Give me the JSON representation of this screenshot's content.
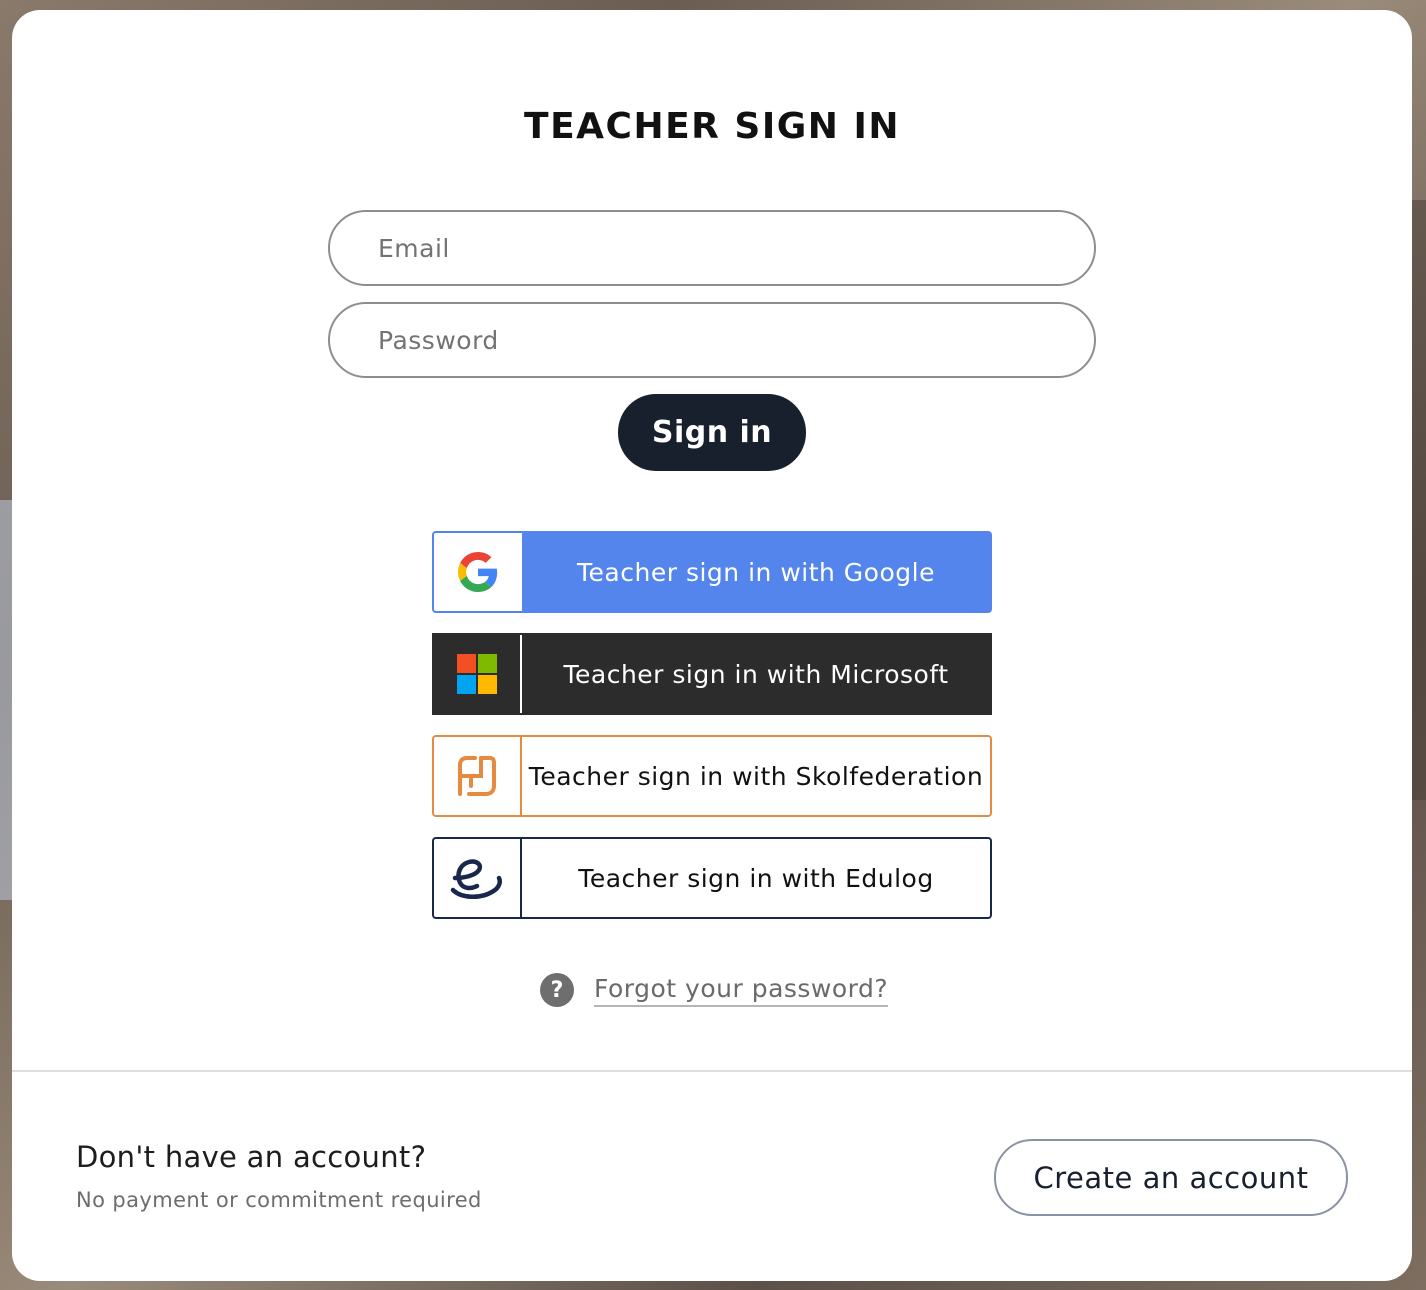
{
  "modal": {
    "title": "TEACHER SIGN IN"
  },
  "form": {
    "email_placeholder": "Email",
    "password_placeholder": "Password",
    "signin_label": "Sign in"
  },
  "sso": [
    {
      "label": "Teacher sign in with Google",
      "icon": "google-icon",
      "color": "#5485ed"
    },
    {
      "label": "Teacher sign in with Microsoft",
      "icon": "microsoft-icon",
      "color": "#2c2c2c"
    },
    {
      "label": "Teacher sign in with Skolfederation",
      "icon": "skolfederation-icon",
      "color": "#e68a3f"
    },
    {
      "label": "Teacher sign in with Edulog",
      "icon": "edulog-icon",
      "color": "#19284a"
    }
  ],
  "forgot": {
    "icon": "help-icon",
    "glyph": "?",
    "label": "Forgot your password?"
  },
  "footer": {
    "heading": "Don't have an account?",
    "subtext": "No payment or commitment required",
    "create_label": "Create an account"
  }
}
